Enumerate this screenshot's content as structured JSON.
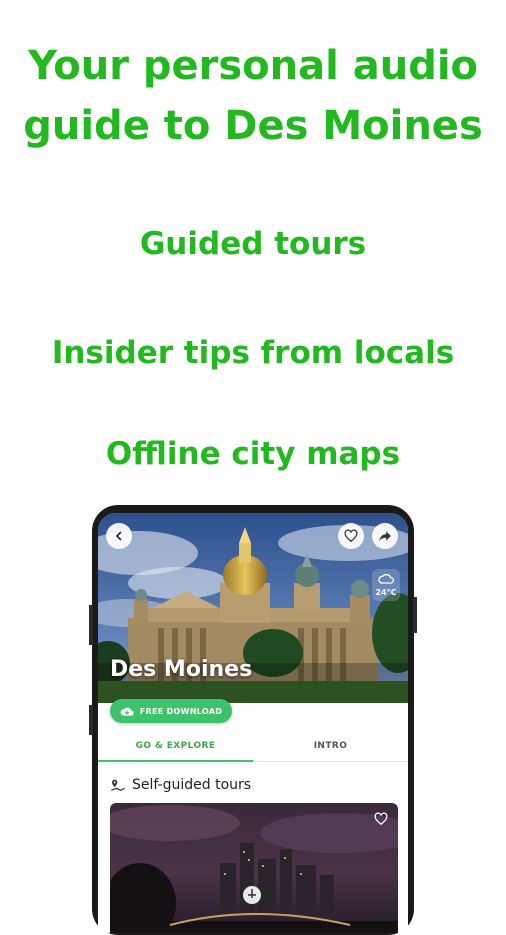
{
  "promo": {
    "headline": "Your personal audio guide to Des Moines",
    "features": [
      "Guided tours",
      "Insider tips from locals",
      "Offline city maps"
    ]
  },
  "app": {
    "city_title": "Des Moines",
    "weather": {
      "temperature": "24°C",
      "icon": "cloud-icon"
    },
    "download_button": {
      "label": "FREE DOWNLOAD",
      "icon": "cloud-download-icon"
    },
    "tabs": [
      {
        "label": "GO & EXPLORE",
        "active": true
      },
      {
        "label": "INTRO",
        "active": false
      }
    ],
    "section": {
      "title": "Self-guided tours",
      "icon": "map-pin-icon"
    }
  },
  "colors": {
    "promo_green": "#22b81f",
    "accent_green": "#3ec26a",
    "phone_frame": "#1a1a1a"
  }
}
